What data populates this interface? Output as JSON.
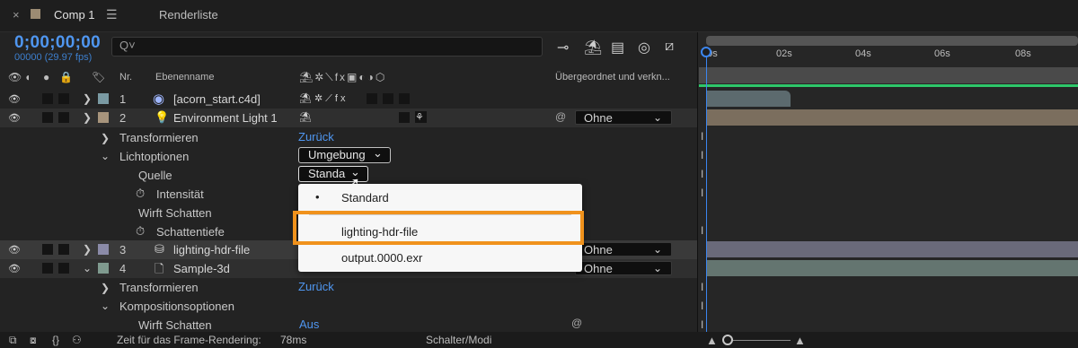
{
  "tabbar": {
    "close": "×",
    "comp_tab": "Comp 1",
    "menu_icon": "hamburger-icon",
    "render_tab": "Renderliste",
    "comp_color": "#9c8b73"
  },
  "controls": {
    "timecode": "0;00;00;00",
    "fps": "00000 (29.97 fps)",
    "search_glyph": "Q˅"
  },
  "header": {
    "nr": "Nr.",
    "layer_name": "Ebenenname",
    "parent": "Übergeordnet und verkn..."
  },
  "layers": [
    {
      "num": "1",
      "name": "[acorn_start.c4d]",
      "color": "#7a9aa3"
    },
    {
      "num": "2",
      "name": "Environment Light 1",
      "color": "#a7947c",
      "parent": "Ohne"
    },
    {
      "num": "3",
      "name": "lighting-hdr-file",
      "color": "#8b8ba8",
      "parent": "Ohne"
    },
    {
      "num": "4",
      "name": "Sample-3d",
      "color": "#7f9a8f",
      "parent": "Ohne"
    }
  ],
  "props": {
    "transform1": "Transformieren",
    "reset1": "Zurück",
    "light_options": "Lichtoptionen",
    "light_type": "Umgebung",
    "source": "Quelle",
    "source_value": "Standa",
    "intensity": "Intensität",
    "casts_shadows": "Wirft Schatten",
    "shadow_depth": "Schattentiefe",
    "transform2": "Transformieren",
    "reset2": "Zurück",
    "comp_options": "Kompositionsoptionen",
    "casts_shadows2": "Wirft Schatten",
    "casts_shadows2_value": "Aus"
  },
  "dropdown": {
    "items": [
      "Standard",
      "lighting-hdr-file",
      "output.0000.exr"
    ],
    "selected_bullet": "•",
    "highlight_color": "#f0921c"
  },
  "timeline": {
    "ticks": [
      "00s",
      "02s",
      "04s",
      "06s",
      "08s"
    ]
  },
  "bottom": {
    "render_time_label": "Zeit für das Frame-Rendering:",
    "render_time_value": "78ms",
    "switches": "Schalter/Modi"
  }
}
